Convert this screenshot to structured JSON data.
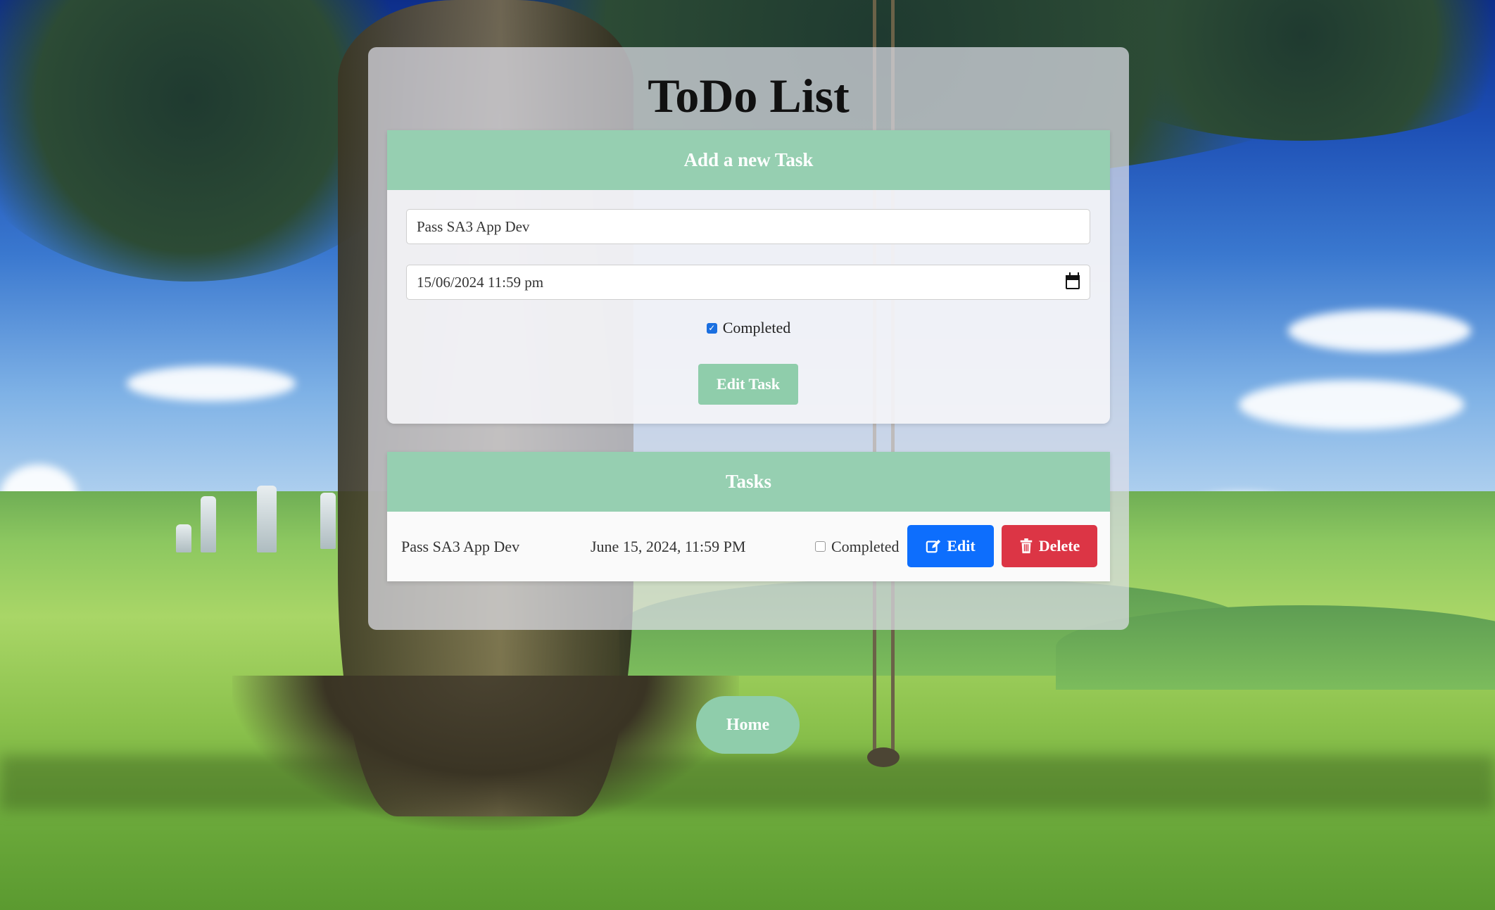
{
  "page": {
    "title": "ToDo List"
  },
  "add_panel": {
    "header": "Add a new Task",
    "task_name_value": "Pass SA3 App Dev",
    "datetime_value": "15/06/2024 11:59 pm",
    "completed_label": "Completed",
    "completed_checked": true,
    "submit_label": "Edit Task"
  },
  "tasks_panel": {
    "header": "Tasks",
    "items": [
      {
        "name": "Pass SA3 App Dev",
        "due": "June 15, 2024, 11:59 PM",
        "completed_label": "Completed",
        "completed": false,
        "edit_label": "Edit",
        "delete_label": "Delete"
      }
    ]
  },
  "nav": {
    "home_label": "Home"
  },
  "icons": {
    "calendar": "calendar-icon",
    "edit": "edit-icon",
    "delete": "trash-icon"
  },
  "colors": {
    "accent_green": "#96cfb1",
    "edit_blue": "#0d6efd",
    "delete_red": "#dc3545"
  }
}
